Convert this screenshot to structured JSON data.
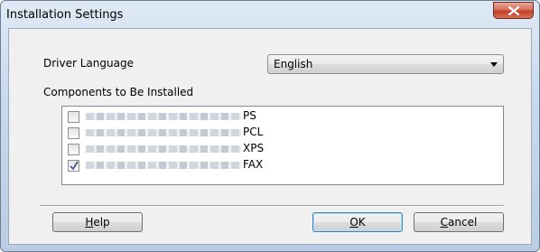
{
  "window": {
    "title": "Installation Settings"
  },
  "driver_language": {
    "label": "Driver Language",
    "selected": "English"
  },
  "components": {
    "label": "Components to Be Installed",
    "items": [
      {
        "suffix": "PS",
        "checked": false
      },
      {
        "suffix": "PCL",
        "checked": false
      },
      {
        "suffix": "XPS",
        "checked": false
      },
      {
        "suffix": "FAX",
        "checked": true
      }
    ]
  },
  "buttons": {
    "help": {
      "mnemonic": "H",
      "rest": "elp"
    },
    "ok": {
      "mnemonic": "O",
      "rest": "K"
    },
    "cancel": {
      "mnemonic": "C",
      "rest": "ancel"
    }
  },
  "colors": {
    "close_button": "#c9452f",
    "default_button_border": "#3c7fb1"
  }
}
